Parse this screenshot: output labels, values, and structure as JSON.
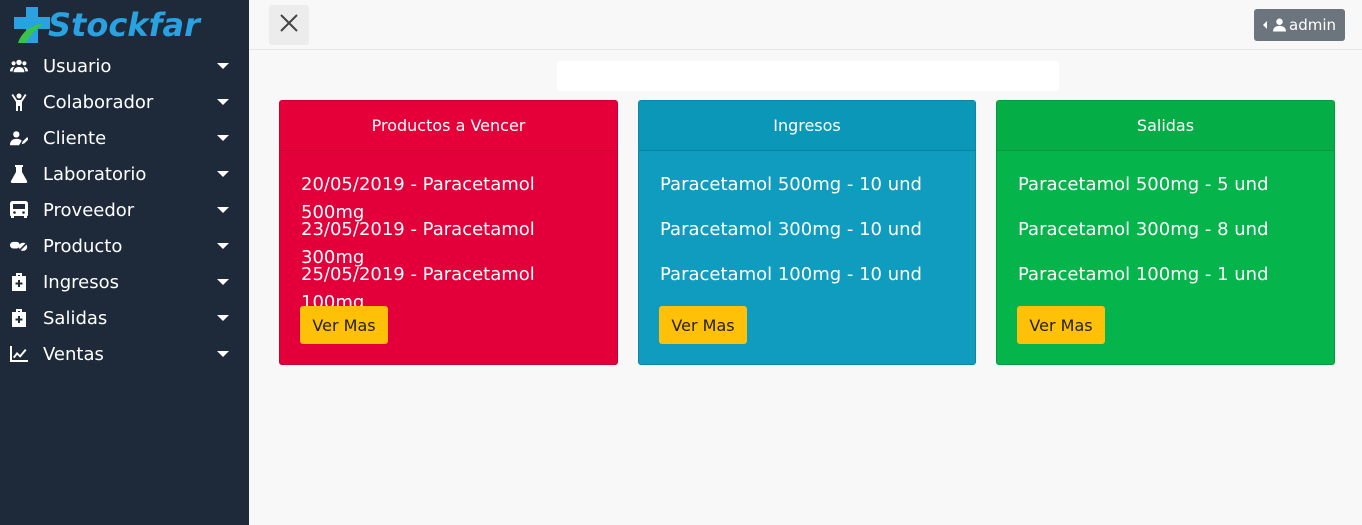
{
  "app": {
    "logo_text": "Stockfar"
  },
  "sidebar": {
    "items": [
      {
        "label": "Usuario",
        "icon": "users-icon"
      },
      {
        "label": "Colaborador",
        "icon": "child-icon"
      },
      {
        "label": "Cliente",
        "icon": "user-edit-icon"
      },
      {
        "label": "Laboratorio",
        "icon": "flask-icon"
      },
      {
        "label": "Proveedor",
        "icon": "bus-icon"
      },
      {
        "label": "Producto",
        "icon": "pills-icon"
      },
      {
        "label": "Ingresos",
        "icon": "briefcase-medical-icon"
      },
      {
        "label": "Salidas",
        "icon": "briefcase-medical-icon"
      },
      {
        "label": "Ventas",
        "icon": "chart-line-icon"
      }
    ]
  },
  "topbar": {
    "user_label": "admin"
  },
  "cards": {
    "vencer": {
      "title": "Productos a Vencer",
      "lines": [
        "20/05/2019 - Paracetamol 500mg",
        "23/05/2019 - Paracetamol 300mg",
        "25/05/2019 - Paracetamol 100mg"
      ],
      "button": "Ver Mas"
    },
    "ingresos": {
      "title": "Ingresos",
      "lines": [
        "Paracetamol 500mg - 10 und",
        "Paracetamol 300mg - 10 und",
        "Paracetamol 100mg - 10 und"
      ],
      "button": "Ver Mas"
    },
    "salidas": {
      "title": "Salidas",
      "lines": [
        "Paracetamol 500mg - 5 und",
        "Paracetamol 300mg - 8 und",
        "Paracetamol 100mg - 1 und"
      ],
      "button": "Ver Mas"
    }
  },
  "colors": {
    "sidebar_bg": "#1e2a3a",
    "brand": "#2aa1e0",
    "red": "#e3003a",
    "teal": "#0f9cbf",
    "green": "#05b44a",
    "button": "#ffc107"
  }
}
